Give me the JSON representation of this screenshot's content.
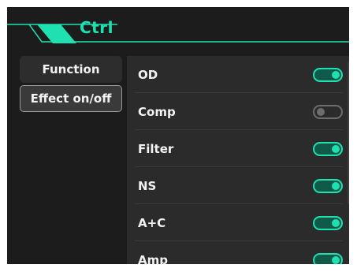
{
  "header": {
    "title": "Ctrl",
    "accent_color": "#1fe0b0"
  },
  "menu": {
    "items": [
      {
        "label": "Function",
        "selected": false
      },
      {
        "label": "Effect on/off",
        "selected": true
      }
    ]
  },
  "effects": [
    {
      "label": "OD",
      "state": "on"
    },
    {
      "label": "Comp",
      "state": "off"
    },
    {
      "label": "Filter",
      "state": "on"
    },
    {
      "label": "NS",
      "state": "on"
    },
    {
      "label": "A+C",
      "state": "on"
    },
    {
      "label": "Amp",
      "state": "on"
    }
  ]
}
